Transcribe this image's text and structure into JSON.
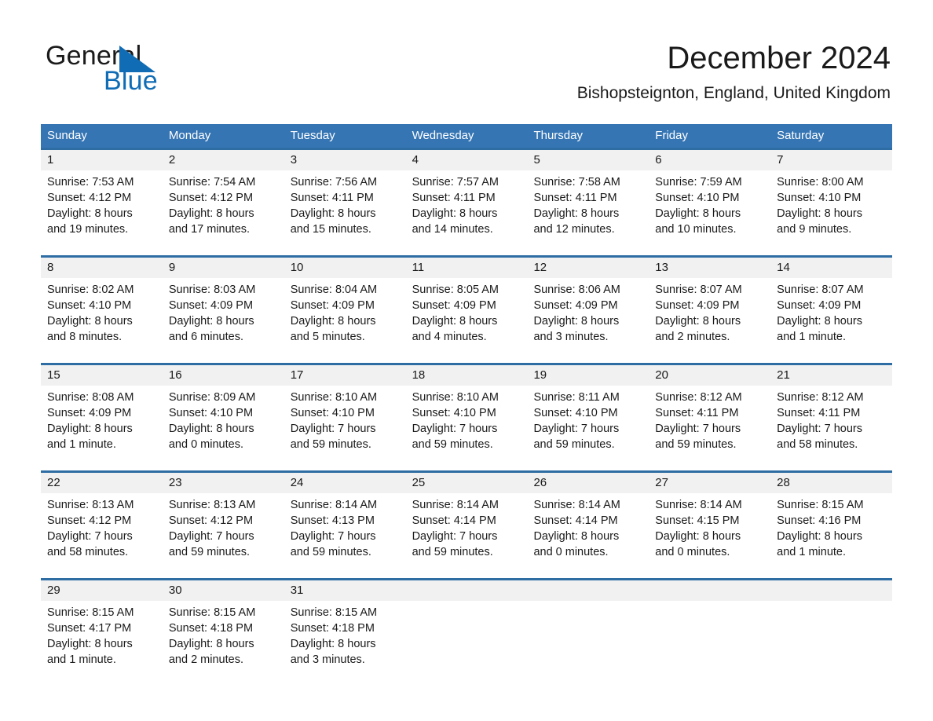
{
  "brand": {
    "name_part1": "General",
    "name_part2": "Blue",
    "triangle_icon": "triangle-logo-icon",
    "accent_color": "#0f6cb5"
  },
  "header": {
    "month_title": "December 2024",
    "location": "Bishopsteignton, England, United Kingdom"
  },
  "theme": {
    "header_blue": "#3575b4",
    "row_divider_blue": "#2e6da4",
    "date_strip_gray": "#f1f1f1"
  },
  "calendar": {
    "weekdays": [
      "Sunday",
      "Monday",
      "Tuesday",
      "Wednesday",
      "Thursday",
      "Friday",
      "Saturday"
    ],
    "weeks": [
      [
        {
          "day": "1",
          "sunrise": "Sunrise: 7:53 AM",
          "sunset": "Sunset: 4:12 PM",
          "daylight_line1": "Daylight: 8 hours",
          "daylight_line2": "and 19 minutes."
        },
        {
          "day": "2",
          "sunrise": "Sunrise: 7:54 AM",
          "sunset": "Sunset: 4:12 PM",
          "daylight_line1": "Daylight: 8 hours",
          "daylight_line2": "and 17 minutes."
        },
        {
          "day": "3",
          "sunrise": "Sunrise: 7:56 AM",
          "sunset": "Sunset: 4:11 PM",
          "daylight_line1": "Daylight: 8 hours",
          "daylight_line2": "and 15 minutes."
        },
        {
          "day": "4",
          "sunrise": "Sunrise: 7:57 AM",
          "sunset": "Sunset: 4:11 PM",
          "daylight_line1": "Daylight: 8 hours",
          "daylight_line2": "and 14 minutes."
        },
        {
          "day": "5",
          "sunrise": "Sunrise: 7:58 AM",
          "sunset": "Sunset: 4:11 PM",
          "daylight_line1": "Daylight: 8 hours",
          "daylight_line2": "and 12 minutes."
        },
        {
          "day": "6",
          "sunrise": "Sunrise: 7:59 AM",
          "sunset": "Sunset: 4:10 PM",
          "daylight_line1": "Daylight: 8 hours",
          "daylight_line2": "and 10 minutes."
        },
        {
          "day": "7",
          "sunrise": "Sunrise: 8:00 AM",
          "sunset": "Sunset: 4:10 PM",
          "daylight_line1": "Daylight: 8 hours",
          "daylight_line2": "and 9 minutes."
        }
      ],
      [
        {
          "day": "8",
          "sunrise": "Sunrise: 8:02 AM",
          "sunset": "Sunset: 4:10 PM",
          "daylight_line1": "Daylight: 8 hours",
          "daylight_line2": "and 8 minutes."
        },
        {
          "day": "9",
          "sunrise": "Sunrise: 8:03 AM",
          "sunset": "Sunset: 4:09 PM",
          "daylight_line1": "Daylight: 8 hours",
          "daylight_line2": "and 6 minutes."
        },
        {
          "day": "10",
          "sunrise": "Sunrise: 8:04 AM",
          "sunset": "Sunset: 4:09 PM",
          "daylight_line1": "Daylight: 8 hours",
          "daylight_line2": "and 5 minutes."
        },
        {
          "day": "11",
          "sunrise": "Sunrise: 8:05 AM",
          "sunset": "Sunset: 4:09 PM",
          "daylight_line1": "Daylight: 8 hours",
          "daylight_line2": "and 4 minutes."
        },
        {
          "day": "12",
          "sunrise": "Sunrise: 8:06 AM",
          "sunset": "Sunset: 4:09 PM",
          "daylight_line1": "Daylight: 8 hours",
          "daylight_line2": "and 3 minutes."
        },
        {
          "day": "13",
          "sunrise": "Sunrise: 8:07 AM",
          "sunset": "Sunset: 4:09 PM",
          "daylight_line1": "Daylight: 8 hours",
          "daylight_line2": "and 2 minutes."
        },
        {
          "day": "14",
          "sunrise": "Sunrise: 8:07 AM",
          "sunset": "Sunset: 4:09 PM",
          "daylight_line1": "Daylight: 8 hours",
          "daylight_line2": "and 1 minute."
        }
      ],
      [
        {
          "day": "15",
          "sunrise": "Sunrise: 8:08 AM",
          "sunset": "Sunset: 4:09 PM",
          "daylight_line1": "Daylight: 8 hours",
          "daylight_line2": "and 1 minute."
        },
        {
          "day": "16",
          "sunrise": "Sunrise: 8:09 AM",
          "sunset": "Sunset: 4:10 PM",
          "daylight_line1": "Daylight: 8 hours",
          "daylight_line2": "and 0 minutes."
        },
        {
          "day": "17",
          "sunrise": "Sunrise: 8:10 AM",
          "sunset": "Sunset: 4:10 PM",
          "daylight_line1": "Daylight: 7 hours",
          "daylight_line2": "and 59 minutes."
        },
        {
          "day": "18",
          "sunrise": "Sunrise: 8:10 AM",
          "sunset": "Sunset: 4:10 PM",
          "daylight_line1": "Daylight: 7 hours",
          "daylight_line2": "and 59 minutes."
        },
        {
          "day": "19",
          "sunrise": "Sunrise: 8:11 AM",
          "sunset": "Sunset: 4:10 PM",
          "daylight_line1": "Daylight: 7 hours",
          "daylight_line2": "and 59 minutes."
        },
        {
          "day": "20",
          "sunrise": "Sunrise: 8:12 AM",
          "sunset": "Sunset: 4:11 PM",
          "daylight_line1": "Daylight: 7 hours",
          "daylight_line2": "and 59 minutes."
        },
        {
          "day": "21",
          "sunrise": "Sunrise: 8:12 AM",
          "sunset": "Sunset: 4:11 PM",
          "daylight_line1": "Daylight: 7 hours",
          "daylight_line2": "and 58 minutes."
        }
      ],
      [
        {
          "day": "22",
          "sunrise": "Sunrise: 8:13 AM",
          "sunset": "Sunset: 4:12 PM",
          "daylight_line1": "Daylight: 7 hours",
          "daylight_line2": "and 58 minutes."
        },
        {
          "day": "23",
          "sunrise": "Sunrise: 8:13 AM",
          "sunset": "Sunset: 4:12 PM",
          "daylight_line1": "Daylight: 7 hours",
          "daylight_line2": "and 59 minutes."
        },
        {
          "day": "24",
          "sunrise": "Sunrise: 8:14 AM",
          "sunset": "Sunset: 4:13 PM",
          "daylight_line1": "Daylight: 7 hours",
          "daylight_line2": "and 59 minutes."
        },
        {
          "day": "25",
          "sunrise": "Sunrise: 8:14 AM",
          "sunset": "Sunset: 4:14 PM",
          "daylight_line1": "Daylight: 7 hours",
          "daylight_line2": "and 59 minutes."
        },
        {
          "day": "26",
          "sunrise": "Sunrise: 8:14 AM",
          "sunset": "Sunset: 4:14 PM",
          "daylight_line1": "Daylight: 8 hours",
          "daylight_line2": "and 0 minutes."
        },
        {
          "day": "27",
          "sunrise": "Sunrise: 8:14 AM",
          "sunset": "Sunset: 4:15 PM",
          "daylight_line1": "Daylight: 8 hours",
          "daylight_line2": "and 0 minutes."
        },
        {
          "day": "28",
          "sunrise": "Sunrise: 8:15 AM",
          "sunset": "Sunset: 4:16 PM",
          "daylight_line1": "Daylight: 8 hours",
          "daylight_line2": "and 1 minute."
        }
      ],
      [
        {
          "day": "29",
          "sunrise": "Sunrise: 8:15 AM",
          "sunset": "Sunset: 4:17 PM",
          "daylight_line1": "Daylight: 8 hours",
          "daylight_line2": "and 1 minute."
        },
        {
          "day": "30",
          "sunrise": "Sunrise: 8:15 AM",
          "sunset": "Sunset: 4:18 PM",
          "daylight_line1": "Daylight: 8 hours",
          "daylight_line2": "and 2 minutes."
        },
        {
          "day": "31",
          "sunrise": "Sunrise: 8:15 AM",
          "sunset": "Sunset: 4:18 PM",
          "daylight_line1": "Daylight: 8 hours",
          "daylight_line2": "and 3 minutes."
        },
        {
          "day": "",
          "sunrise": "",
          "sunset": "",
          "daylight_line1": "",
          "daylight_line2": ""
        },
        {
          "day": "",
          "sunrise": "",
          "sunset": "",
          "daylight_line1": "",
          "daylight_line2": ""
        },
        {
          "day": "",
          "sunrise": "",
          "sunset": "",
          "daylight_line1": "",
          "daylight_line2": ""
        },
        {
          "day": "",
          "sunrise": "",
          "sunset": "",
          "daylight_line1": "",
          "daylight_line2": ""
        }
      ]
    ]
  }
}
